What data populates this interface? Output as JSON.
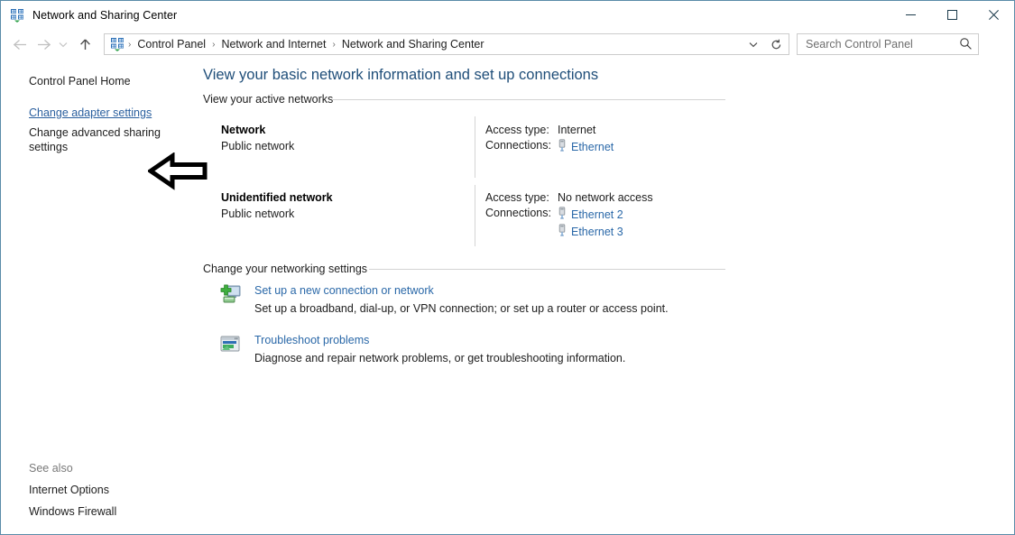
{
  "window": {
    "title": "Network and Sharing Center",
    "app_icon": "network-icon",
    "minimize_label": "Minimize",
    "maximize_label": "Maximize",
    "close_label": "Close"
  },
  "addressbar": {
    "back_label": "Back",
    "forward_label": "Forward",
    "recent_label": "Recent locations",
    "up_label": "Up one level",
    "breadcrumb": [
      "Control Panel",
      "Network and Internet",
      "Network and Sharing Center"
    ],
    "separator": "›",
    "chevron_label": "Previous locations",
    "refresh_label": "Refresh"
  },
  "search": {
    "placeholder": "Search Control Panel",
    "value": "",
    "icon": "search-icon"
  },
  "sidebar": {
    "control_panel_home": "Control Panel Home",
    "change_adapter_settings": "Change adapter settings",
    "change_advanced_sharing": "Change advanced sharing settings",
    "see_also_title": "See also",
    "see_also": [
      "Internet Options",
      "Windows Firewall"
    ]
  },
  "main": {
    "heading": "View your basic network information and set up connections",
    "active_networks_label": "View your active networks",
    "networking_settings_label": "Change your networking settings",
    "labels": {
      "access_type": "Access type:",
      "connections": "Connections:"
    },
    "networks": [
      {
        "name": "Network",
        "type": "Public network",
        "access_type": "Internet",
        "connections": [
          "Ethernet"
        ]
      },
      {
        "name": "Unidentified network",
        "type": "Public network",
        "access_type": "No network access",
        "connections": [
          "Ethernet 2",
          "Ethernet 3"
        ]
      }
    ],
    "settings": [
      {
        "icon": "new-connection-icon",
        "link": "Set up a new connection or network",
        "description": "Set up a broadband, dial-up, or VPN connection; or set up a router or access point."
      },
      {
        "icon": "troubleshoot-icon",
        "link": "Troubleshoot problems",
        "description": "Diagnose and repair network problems, or get troubleshooting information."
      }
    ]
  },
  "annotation": {
    "arrow": "left-pointing-arrow",
    "points_to": "Change adapter settings"
  },
  "colors": {
    "heading_blue": "#1f4e79",
    "link_blue": "#2a68a8",
    "sidebar_link_blue": "#2a5f9e",
    "window_border": "#5a8ca8",
    "rule_gray": "#d4d4d4"
  }
}
